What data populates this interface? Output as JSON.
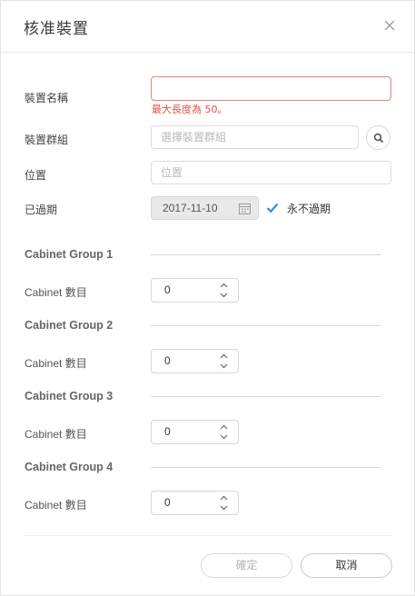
{
  "dialog": {
    "title": "核准裝置"
  },
  "form": {
    "device_name": {
      "label": "裝置名稱",
      "value": "",
      "error": "最大長度為 50。"
    },
    "device_group": {
      "label": "裝置群組",
      "placeholder": "選擇裝置群組"
    },
    "location": {
      "label": "位置",
      "placeholder": "位置"
    },
    "expiry": {
      "label": "已過期",
      "date": "2017-11-10",
      "never_label": "永不過期",
      "never_checked": true
    }
  },
  "cabinet_groups": [
    {
      "title": "Cabinet Group 1",
      "count_label": "Cabinet 數目",
      "count": "0"
    },
    {
      "title": "Cabinet Group 2",
      "count_label": "Cabinet 數目",
      "count": "0"
    },
    {
      "title": "Cabinet Group 3",
      "count_label": "Cabinet 數目",
      "count": "0"
    },
    {
      "title": "Cabinet Group 4",
      "count_label": "Cabinet 數目",
      "count": "0"
    }
  ],
  "footer": {
    "confirm_label": "確定",
    "cancel_label": "取消"
  },
  "colors": {
    "error": "#e0504d",
    "check": "#2f8fdc",
    "border": "#dcdcdc"
  },
  "icons": {
    "close": "close-icon",
    "search": "search-icon",
    "calendar": "calendar-icon",
    "checkbox": "checkbox-checked-icon"
  }
}
